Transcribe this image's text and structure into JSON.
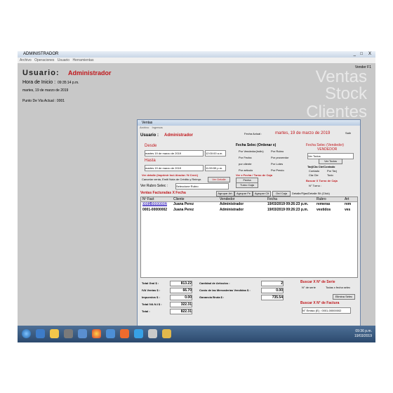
{
  "window": {
    "title": "ADMINISTRADOR",
    "min": "_",
    "max": "□",
    "close": "X"
  },
  "menu": [
    "Archivo",
    "Operaciones",
    "Usuario",
    "Herramientas"
  ],
  "main": {
    "usuario_label": "Usuario:",
    "usuario_value": "Administrador",
    "hora_label": "Hora de Inicio :",
    "hora_value": "09:35:14 p.m.",
    "fecha": "martes, 19 de marzo de 2019",
    "punto": "Punto De Vta Actual :  0001",
    "vender": "Vender F1",
    "bigwords": [
      "Ventas",
      "Stock",
      "Clientes"
    ]
  },
  "dialog": {
    "title": "Ventas",
    "menu": [
      "Archivo",
      "Ingresos"
    ],
    "usuario_label": "Usuario :",
    "usuario_value": "Administrador",
    "fecha_actual_label": "Fecha Actual :",
    "fecha_actual_value": "martes, 19 de marzo de 2019",
    "salir": "Salir",
    "desde_label": "Desde",
    "desde_date": "martes   19 de   marzo   de 2019",
    "desde_time": "12:00:00 a.m.",
    "hasta_label": "Hasta",
    "hasta_date": "martes   19 de   marzo   de 2019",
    "hasta_time": "11:59:59 p.m.",
    "ver_detalle": "Ver detalle (Imprimir Incl./Anular / N Cred.)",
    "cancelar_text": "Cancelar venta, Emiti Nota de Crédito y Reimpr.",
    "ver_detalle_btn": "Ver Detalle",
    "ver_rubro_label": "Ver Rubro Selec :",
    "ver_rubro_value": "Seleccione Rubro",
    "fecha_selec_title": "Fecha Selec (Ordenar x)",
    "radios": [
      "Por Vendedor(Indiv)",
      "Por Rubro",
      "Por Fecha",
      "Por proveedor",
      "por cliente",
      "Por Lotes",
      "Por articulo",
      "Por Precio"
    ],
    "ver_fecha": "Ver x Fecha / Turno de Caja",
    "fecha_btn": "Fecha",
    "turno_btn": "Turno Caja",
    "fecha_selec_vend": "Fecha Selec (Vendedor)",
    "vendedor_label": "VENDEDOR",
    "vendedor_value": "Ver Todos",
    "ver_todos": "Ver Todos",
    "tarj_title": "Tarj/Cta Cte/Contado",
    "tarj_opts": [
      "Contado",
      "Por Tarj",
      "Cta Cte",
      "Todo"
    ],
    "buscar_turno": "Buscar X Turno de Caja",
    "nturno_label": "N° Turno :",
    "ventas_fact": "Ventas Facturadas X Fecha",
    "agrupar": [
      "Agrupar Art.",
      "Agrupar Fe",
      "Agrupar Clt",
      "Ord Caja"
    ],
    "detalle_text": "Detalle/Fijas/Detalle Sit (Click)",
    "columns": [
      "Nº Fact",
      "Cliente",
      "Vendedor",
      "Fecha",
      "Rubro",
      "Art"
    ],
    "rows": [
      {
        "nfact": "0001-00000002",
        "cliente": "Juana Perez",
        "vendedor": "Administrador",
        "fecha": "19/03/2019 09:26:23 p.m.",
        "rubro": "remeras",
        "art": "rem"
      },
      {
        "nfact": "0001-00000002",
        "cliente": "Juana Perez",
        "vendedor": "Administrador",
        "fecha": "19/03/2019 09:26:23 p.m.",
        "rubro": "vestidos",
        "art": "ves"
      }
    ],
    "totals": [
      {
        "label": "Total Gral $ :",
        "value": "813.22"
      },
      {
        "label": "IVA Ventas $ :",
        "value": "66.70"
      },
      {
        "label": "Impuestos $ :",
        "value": "0.00"
      },
      {
        "label": "Total IVA N.I $ :",
        "value": "322.31"
      },
      {
        "label": "Total :",
        "value": "822.31"
      }
    ],
    "cantidad_label": "Cantidad de Artículos :",
    "cantidad_value": "2",
    "costo_label": "Costo de las Mercaderías Vendidas $ :",
    "costo_value": "0.00",
    "ganancia_label": "Ganancia Bruta $ :",
    "ganancia_value": "735.54",
    "buscar_serie": "Buscar  X  N° de Serie",
    "nserie_label": "N° de serie",
    "todas_text": "Todas x fecha selec",
    "elimina": "Elimina Selec",
    "buscar_factura": "Buscar  X  N° de Factura",
    "nfact_value": "N° Emisio (E) : 0001-00000002"
  },
  "clock": {
    "time": "09:36 p.m.",
    "date": "19/03/2019"
  }
}
